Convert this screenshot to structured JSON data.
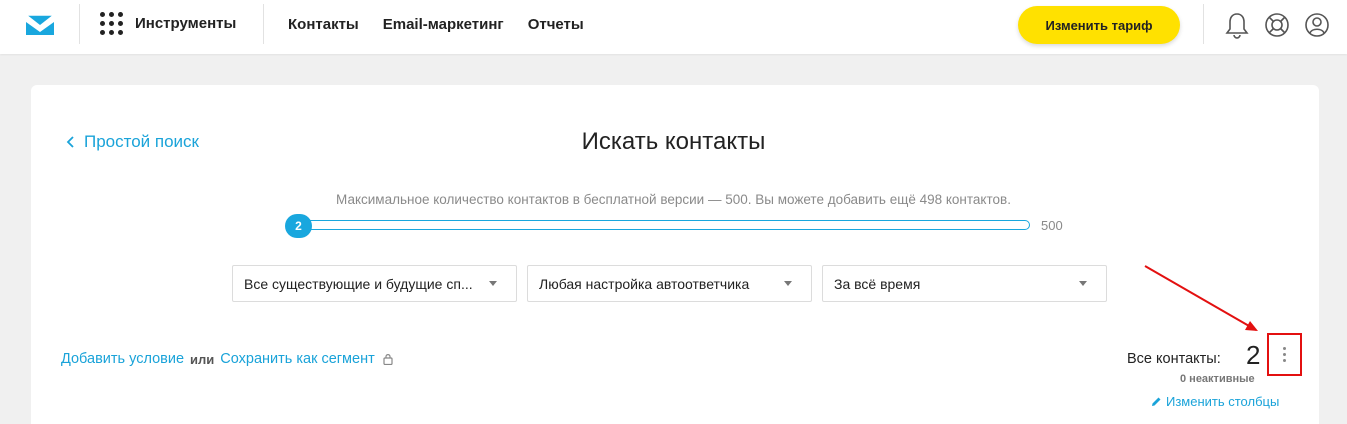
{
  "nav": {
    "tools_label": "Инструменты",
    "links": [
      "Контакты",
      "Email-маркетинг",
      "Отчеты"
    ],
    "plan_button": "Изменить тариф",
    "icons": [
      "bell-icon",
      "help-lifebuoy-icon",
      "user-icon"
    ],
    "brand_color": "#19a7de",
    "plan_color": "#ffe100"
  },
  "page": {
    "back_link": "Простой поиск",
    "title": "Искать контакты",
    "limit_text": "Максимальное количество контактов в бесплатной версии — 500. Вы можете добавить ещё 498 контактов.",
    "slider": {
      "value": "2",
      "max": "500",
      "fill_fraction": 0.004
    }
  },
  "filters": {
    "lists": "Все существующие и будущие сп...",
    "autoresponder": "Любая настройка автоответчика",
    "period": "За всё время"
  },
  "actions": {
    "add_condition": "Добавить условие",
    "or": "или",
    "save_segment": "Сохранить как сегмент"
  },
  "summary": {
    "all_contacts_label": "Все контакты:",
    "count": "2",
    "inactive": "0 неактивные",
    "edit_columns": "Изменить столбцы",
    "highlight_color": "#e31010"
  }
}
